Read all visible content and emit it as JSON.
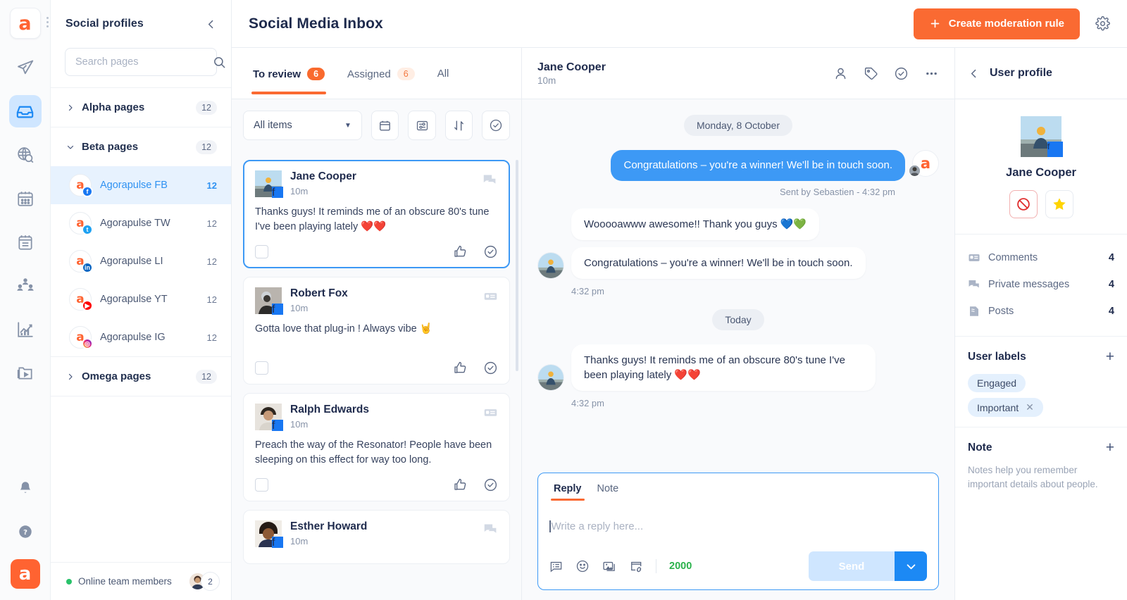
{
  "brand": {
    "accent": "#fa6a32",
    "blue": "#3d99f5",
    "logo_glyph": "a"
  },
  "rail": {
    "items": [
      {
        "name": "publishing-icon",
        "label": "Publishing"
      },
      {
        "name": "inbox-icon",
        "label": "Inbox",
        "active": true
      },
      {
        "name": "listening-icon",
        "label": "Listening"
      },
      {
        "name": "calendar-icon",
        "label": "Calendar"
      },
      {
        "name": "reports-icon",
        "label": "Content"
      },
      {
        "name": "audience-icon",
        "label": "Audience"
      },
      {
        "name": "analytics-icon",
        "label": "Analytics"
      },
      {
        "name": "library-icon",
        "label": "Library"
      }
    ],
    "bottom": [
      {
        "name": "notifications-icon",
        "label": "Notifications"
      },
      {
        "name": "help-icon",
        "label": "Help"
      }
    ]
  },
  "profiles": {
    "title": "Social profiles",
    "collapse_label": "Collapse",
    "search": {
      "value": "",
      "placeholder": "Search pages"
    },
    "groups": [
      {
        "label": "Alpha pages",
        "count": "12",
        "expanded": false
      },
      {
        "label": "Beta pages",
        "count": "12",
        "expanded": true
      },
      {
        "label": "Omega pages",
        "count": "12",
        "expanded": false
      }
    ],
    "pages": [
      {
        "label": "Agorapulse FB",
        "count": "12",
        "network": "fb",
        "selected": true
      },
      {
        "label": "Agorapulse TW",
        "count": "12",
        "network": "tw",
        "selected": false
      },
      {
        "label": "Agorapulse LI",
        "count": "12",
        "network": "li",
        "selected": false
      },
      {
        "label": "Agorapulse YT",
        "count": "12",
        "network": "yt",
        "selected": false
      },
      {
        "label": "Agorapulse IG",
        "count": "12",
        "network": "ig",
        "selected": false
      }
    ],
    "online": {
      "label": "Online team members",
      "count": "2"
    }
  },
  "topbar": {
    "title": "Social Media Inbox",
    "create_rule_label": "Create moderation rule",
    "settings_label": "Settings"
  },
  "inbox": {
    "tabs": [
      {
        "label": "To review",
        "badge": "6",
        "active": true
      },
      {
        "label": "Assigned",
        "badge": "6",
        "active": false
      },
      {
        "label": "All",
        "badge": "",
        "active": false
      }
    ],
    "filter": {
      "selected": "All items"
    },
    "tool_buttons": [
      {
        "name": "calendar-icon",
        "label": "Date range"
      },
      {
        "name": "sliders-icon",
        "label": "Filters"
      },
      {
        "name": "sort-icon",
        "label": "Sort"
      },
      {
        "name": "check-circle-icon",
        "label": "Mark as reviewed"
      }
    ],
    "items": [
      {
        "name": "Jane Cooper",
        "time": "10m",
        "text": "Thanks guys! It reminds me of an obscure 80's tune I've been playing lately ❤️❤️",
        "type": "comment",
        "network": "fb",
        "selected": true
      },
      {
        "name": "Robert Fox",
        "time": "10m",
        "text": "Gotta love that plug-in ! Always vibe 🤘",
        "type": "post",
        "network": "fb",
        "selected": false
      },
      {
        "name": "Ralph Edwards",
        "time": "10m",
        "text": "Preach the way of the Resonator! People have been sleeping on this effect for way too long.",
        "type": "post",
        "network": "fb",
        "selected": false
      },
      {
        "name": "Esther Howard",
        "time": "10m",
        "text": "",
        "type": "comment",
        "network": "fb",
        "selected": false
      }
    ]
  },
  "conversation": {
    "header": {
      "name": "Jane Cooper",
      "time": "10m"
    },
    "header_actions": [
      {
        "name": "user-icon",
        "label": "User profile"
      },
      {
        "name": "tag-icon",
        "label": "Label"
      },
      {
        "name": "check-circle-icon",
        "label": "Review"
      },
      {
        "name": "more-icon",
        "label": "More"
      }
    ],
    "day_separators": {
      "first": "Monday, 8 October",
      "second": "Today"
    },
    "messages": [
      {
        "direction": "out",
        "text": "Congratulations – you're a winner! We'll be in touch soon.",
        "meta": "Sent by Sebastien - 4:32 pm"
      },
      {
        "direction": "in",
        "text": "Wooooawww awesome!! Thank you guys 💙💚",
        "meta": ""
      },
      {
        "direction": "in",
        "text": "Congratulations – you're a winner! We'll be in touch soon.",
        "meta": "4:32 pm"
      },
      {
        "direction": "in",
        "text": "Thanks guys! It reminds me of an obscure 80's tune I've been playing lately ❤️❤️",
        "meta": "4:32 pm"
      }
    ],
    "composer": {
      "tabs": [
        {
          "label": "Reply",
          "active": true
        },
        {
          "label": "Note",
          "active": false
        }
      ],
      "value": "",
      "placeholder": "Write a reply here...",
      "char_count": "2000",
      "send_label": "Send",
      "tools": [
        {
          "name": "saved-replies-icon",
          "label": "Saved replies"
        },
        {
          "name": "emoji-icon",
          "label": "Emoji"
        },
        {
          "name": "image-icon",
          "label": "Attach image"
        },
        {
          "name": "link-icon",
          "label": "Attach link"
        }
      ]
    }
  },
  "user_profile": {
    "title": "User profile",
    "back_label": "Back",
    "name": "Jane Cooper",
    "actions": [
      {
        "name": "block-icon",
        "label": "Block user",
        "glyph": "🚫"
      },
      {
        "name": "star-icon",
        "label": "Favorite user",
        "glyph": "⭐"
      }
    ],
    "stats": [
      {
        "icon": "comments-icon",
        "label": "Comments",
        "value": "4"
      },
      {
        "icon": "private-messages-icon",
        "label": "Private messages",
        "value": "4"
      },
      {
        "icon": "posts-icon",
        "label": "Posts",
        "value": "4"
      }
    ],
    "labels_section": {
      "title": "User labels",
      "add_label": "+",
      "labels": [
        {
          "text": "Engaged",
          "removable": false
        },
        {
          "text": "Important",
          "removable": true
        }
      ]
    },
    "note_section": {
      "title": "Note",
      "add_label": "+",
      "placeholder": "Notes help you remember important details about people."
    }
  }
}
